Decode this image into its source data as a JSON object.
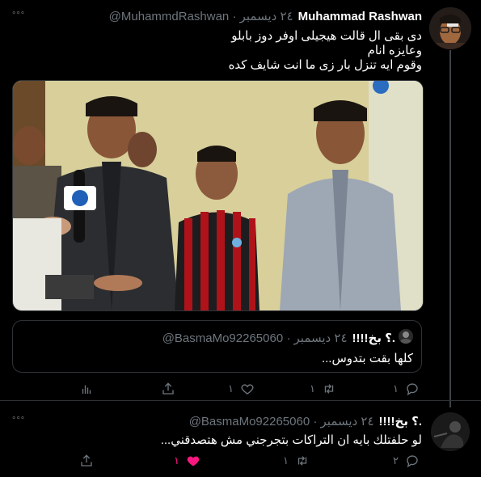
{
  "tweet1": {
    "name": "Muhammad Rashwan",
    "handle_date": "@MuhammdRashwan · ٢٤ ديسمبر",
    "menu": "°°°",
    "body": [
      "دى بقى ال قالت هيجيلى اوفر دوز بابلو",
      "وعايزه انام",
      "وقوم ايه تنزل بار زى ما انت شايف كده"
    ],
    "quote": {
      "name": "!!!!؟ بخ.",
      "handle_date": "@BasmaMo92265060 · ٢٤ ديسمبر",
      "body": "كلها بقت بتدوس..."
    },
    "actions": {
      "reply_count": "١",
      "retweet_count": "١",
      "like_count": "١"
    }
  },
  "tweet2": {
    "name": "!!!!؟ بخ.",
    "handle_date": "@BasmaMo92265060 · ٢٤ ديسمبر",
    "menu": "°°°",
    "body": "لو حلفتلك بايه ان التراكات بتجرجني مش هتصدقني...",
    "actions": {
      "reply_count": "٢",
      "retweet_count": "١",
      "like_count": "١"
    }
  },
  "colors": {
    "background": "#000000",
    "muted": "#6e767d",
    "liked": "#f91880"
  }
}
